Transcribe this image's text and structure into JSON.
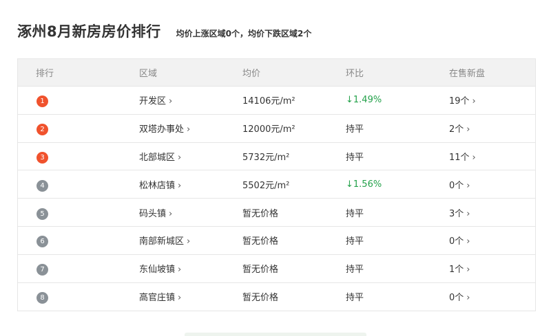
{
  "page": {
    "title": "涿州8月新房房价排行",
    "summary": "均价上涨区域0个，均价下跌区域2个"
  },
  "colors": {
    "top_rank": "#f0522d",
    "other_rank": "#8a9197",
    "trend_down": "#23a14a",
    "header_bg": "#f2f2f2"
  },
  "table": {
    "headers": [
      "排行",
      "区域",
      "均价",
      "环比",
      "在售新盘"
    ],
    "chevron": "›",
    "rows": [
      {
        "rank": "1",
        "area": "开发区",
        "price": "14106元/m²",
        "trend": "↓1.49%",
        "trend_dir": "down",
        "count": "19个",
        "top": true
      },
      {
        "rank": "2",
        "area": "双塔办事处",
        "price": "12000元/m²",
        "trend": "持平",
        "trend_dir": "flat",
        "count": "2个",
        "top": true
      },
      {
        "rank": "3",
        "area": "北部城区",
        "price": "5732元/m²",
        "trend": "持平",
        "trend_dir": "flat",
        "count": "11个",
        "top": true
      },
      {
        "rank": "4",
        "area": "松林店镇",
        "price": "5502元/m²",
        "trend": "↓1.56%",
        "trend_dir": "down",
        "count": "0个",
        "top": false
      },
      {
        "rank": "5",
        "area": "码头镇",
        "price": "暂无价格",
        "trend": "持平",
        "trend_dir": "flat",
        "count": "3个",
        "top": false
      },
      {
        "rank": "6",
        "area": "南部新城区",
        "price": "暂无价格",
        "trend": "持平",
        "trend_dir": "flat",
        "count": "0个",
        "top": false
      },
      {
        "rank": "7",
        "area": "东仙坡镇",
        "price": "暂无价格",
        "trend": "持平",
        "trend_dir": "flat",
        "count": "1个",
        "top": false
      },
      {
        "rank": "8",
        "area": "高官庄镇",
        "price": "暂无价格",
        "trend": "持平",
        "trend_dir": "flat",
        "count": "0个",
        "top": false
      }
    ]
  }
}
